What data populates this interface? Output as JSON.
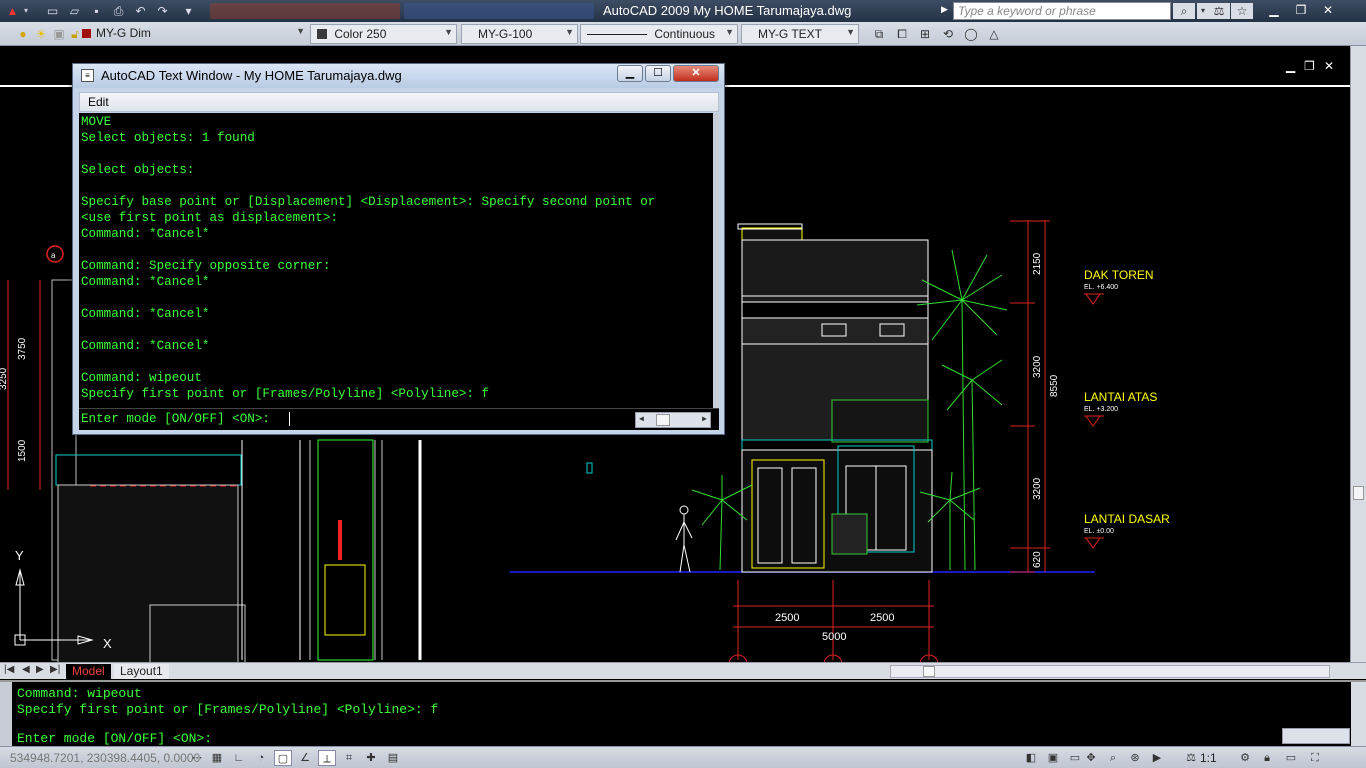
{
  "titlebar": {
    "title": "AutoCAD 2009 My HOME Tarumajaya.dwg",
    "search_placeholder": "Type a keyword or phrase"
  },
  "toolbar": {
    "layer": "MY-G Dim",
    "color": "Color 250",
    "dimstyle": "MY-G-100",
    "linetype": "Continuous",
    "textstyle": "MY-G TEXT"
  },
  "text_window": {
    "title": "AutoCAD Text Window - My HOME Tarumajaya.dwg",
    "menu_edit": "Edit",
    "lines": [
      "MOVE",
      "Select objects: 1 found",
      "",
      "Select objects:",
      "",
      "Specify base point or [Displacement] <Displacement>: Specify second point or",
      "<use first point as displacement>:",
      "Command: *Cancel*",
      "",
      "Command: Specify opposite corner:",
      "Command: *Cancel*",
      "",
      "Command: *Cancel*",
      "",
      "Command: *Cancel*",
      "",
      "Command: wipeout",
      "Specify first point or [Frames/Polyline] <Polyline>: f"
    ],
    "prompt": "Enter mode [ON/OFF] <ON>: "
  },
  "drawing": {
    "levels": [
      {
        "name": "DAK TOREN",
        "el": "EL. +6.400"
      },
      {
        "name": "LANTAI ATAS",
        "el": "EL. +3.200"
      },
      {
        "name": "LANTAI DASAR",
        "el": "EL. ±0.00"
      }
    ],
    "vertical_dims": [
      "2150",
      "3200",
      "3200",
      "620"
    ],
    "total_height": "8550",
    "horizontal_dims": [
      "2500",
      "2500"
    ],
    "total_width": "5000",
    "left_dims": [
      "3750",
      "3250",
      "1500"
    ],
    "ucs_y": "Y",
    "ucs_x": "X"
  },
  "tabs": {
    "model": "Model",
    "layout1": "Layout1"
  },
  "command_line": {
    "line1": "Command: wipeout",
    "line2": "Specify first point or [Frames/Polyline] <Polyline>: f",
    "line3": "Enter mode [ON/OFF] <ON>:"
  },
  "status": {
    "coords": "534948.7201, 230398.4405, 0.0000",
    "scale": "1:1"
  },
  "colors": {
    "command_text": "#3dff3d",
    "drawing_bg": "#000000",
    "building_lines": "#ffffff",
    "level_text": "#ffff00",
    "dim_red": "#ff2020",
    "wall_cyan": "#00c8c8"
  }
}
